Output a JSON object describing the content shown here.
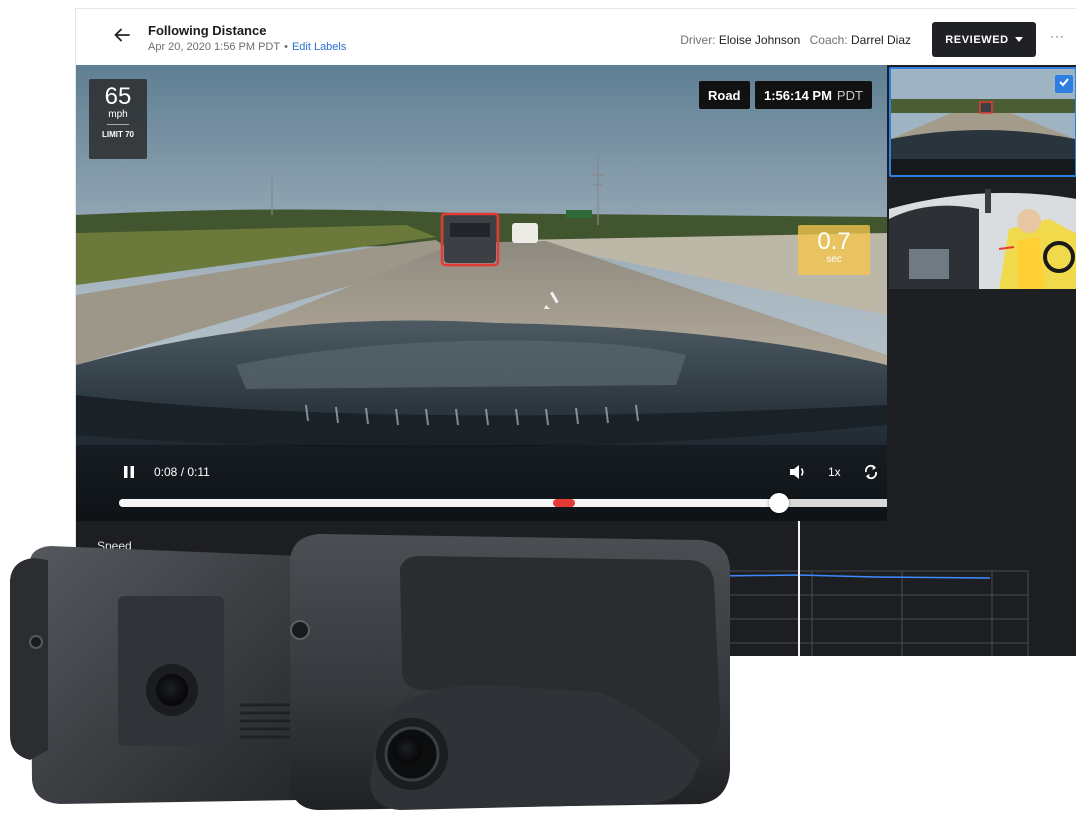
{
  "header": {
    "back_label": "Back",
    "title": "Following Distance",
    "datetime": "Apr 20, 2020 1:56 PM PDT",
    "separator": "•",
    "edit_labels": "Edit Labels",
    "driver_label": "Driver:",
    "driver_name": "Eloise Johnson",
    "coach_label": "Coach:",
    "coach_name": "Darrel Diaz",
    "status_button": "REVIEWED",
    "more": "···"
  },
  "video": {
    "speed_value": "65",
    "speed_unit": "mph",
    "speed_limit": "LIMIT 70",
    "view_tag": "Road",
    "clock_time": "1:56:14 PM",
    "clock_tz": "PDT",
    "distance_value": "0.7",
    "distance_unit": "sec",
    "time_display": "0:08 / 0:11",
    "playback_rate": "1x",
    "progress_fraction": 0.727,
    "event_marker_fraction": 0.49
  },
  "thumbnails": [
    {
      "name": "road-camera",
      "selected": true
    },
    {
      "name": "driver-camera",
      "selected": false
    }
  ],
  "speed_panel": {
    "label": "Speed"
  },
  "icons": {
    "back": "arrow-left-icon",
    "pause": "pause-icon",
    "volume": "volume-icon",
    "loop": "loop-icon",
    "download": "download-icon",
    "layers": "layers-icon",
    "layout": "layout-icon",
    "fullscreen": "fullscreen-icon",
    "check": "check-icon"
  },
  "colors": {
    "accent": "#2f7fe0",
    "status_button": "#1f2125",
    "event_marker": "#e53935",
    "distance_warning": "#f3c64c",
    "speed_line": "#3d8bff"
  }
}
